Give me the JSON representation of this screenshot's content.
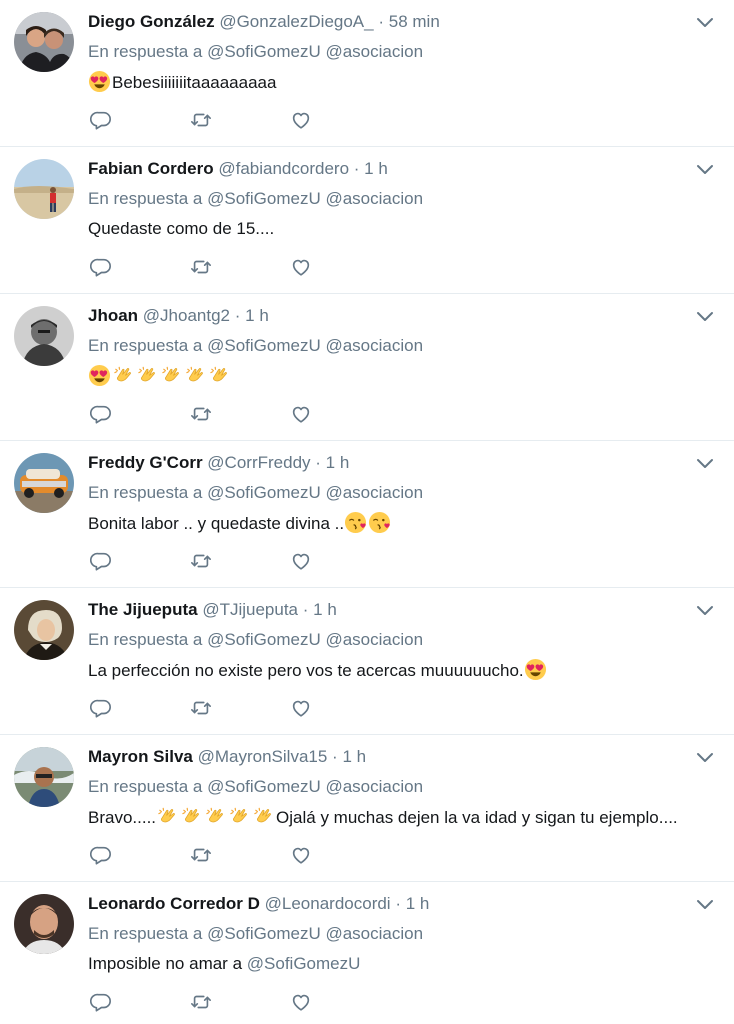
{
  "colors": {
    "name": "#14171a",
    "secondary": "#657786",
    "divider": "#e6ecf0",
    "background": "#ffffff"
  },
  "tweets": [
    {
      "name": "Diego González",
      "handle": "@GonzalezDiegoA_",
      "time": "58 min",
      "reply_prefix": "En respuesta a",
      "reply_mentions": "@SofiGomezU @asociacion",
      "text": "Bebesiiiiiiitaaaaaaaaa",
      "emojis_before": [
        "heart-eyes-emoji"
      ]
    },
    {
      "name": "Fabian Cordero",
      "handle": "@fabiandcordero",
      "time": "1 h",
      "reply_prefix": "En respuesta a",
      "reply_mentions": "@SofiGomezU @asociacion",
      "text": "Quedaste como de 15...."
    },
    {
      "name": "Jhoan",
      "handle": "@Jhoantg2",
      "time": "1 h",
      "reply_prefix": "En respuesta a",
      "reply_mentions": "@SofiGomezU @asociacion",
      "text": "",
      "emojis_before": [
        "heart-eyes-emoji",
        "clapping-hands-emoji",
        "clapping-hands-emoji",
        "clapping-hands-emoji",
        "clapping-hands-emoji",
        "clapping-hands-emoji"
      ]
    },
    {
      "name": "Freddy G'Corr",
      "handle": "@CorrFreddy",
      "time": "1 h",
      "reply_prefix": "En respuesta a",
      "reply_mentions": "@SofiGomezU @asociacion",
      "text": "Bonita labor .. y quedaste divina ..",
      "emojis_after": [
        "face-blowing-kiss-emoji",
        "face-blowing-kiss-emoji"
      ]
    },
    {
      "name": "The Jijueputa",
      "handle": "@TJijueputa",
      "time": "1 h",
      "reply_prefix": "En respuesta a",
      "reply_mentions": "@SofiGomezU @asociacion",
      "text": "La perfección no existe pero vos te acercas muuuuuucho.",
      "emojis_after": [
        "heart-eyes-emoji"
      ]
    },
    {
      "name": "Mayron Silva",
      "handle": "@MayronSilva15",
      "time": "1 h",
      "reply_prefix": "En respuesta a",
      "reply_mentions": "@SofiGomezU @asociacion",
      "text": "Bravo.....",
      "emojis_after": [
        "clapping-hands-emoji",
        "clapping-hands-emoji",
        "clapping-hands-emoji",
        "clapping-hands-emoji",
        "clapping-hands-emoji"
      ],
      "text_tail": "Ojalá y muchas dejen la va idad y sigan tu ejemplo...."
    },
    {
      "name": "Leonardo Corredor D",
      "handle": "@Leonardocordi",
      "time": "1 h",
      "reply_prefix": "En respuesta a",
      "reply_mentions": "@SofiGomezU @asociacion",
      "text": "Imposible no amar a",
      "text_link": "@SofiGomezU"
    }
  ],
  "separator": "·",
  "icons": {
    "reply": "reply-icon",
    "retweet": "retweet-icon",
    "like": "like-icon",
    "caret": "chevron-down-icon"
  }
}
